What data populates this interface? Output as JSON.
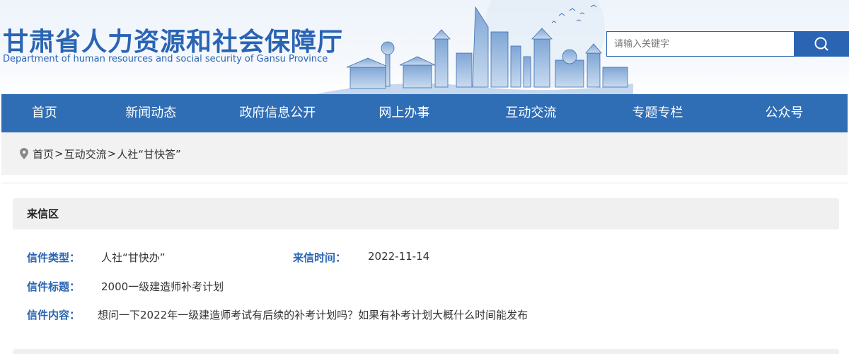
{
  "header": {
    "title": "甘肃省人力资源和社会保障厅",
    "subtitle": "Department of human resources and social security of Gansu Province",
    "search_placeholder": "请输入关键字",
    "search_icon": "search-icon"
  },
  "nav": {
    "items": [
      {
        "label": "首页"
      },
      {
        "label": "新闻动态"
      },
      {
        "label": "政府信息公开"
      },
      {
        "label": "网上办事"
      },
      {
        "label": "互动交流"
      },
      {
        "label": "专题专栏"
      },
      {
        "label": "公众号"
      }
    ]
  },
  "breadcrumb": {
    "icon": "location-pin-icon",
    "items": [
      "首页",
      "互动交流",
      "人社“甘快答”"
    ],
    "separator": ">"
  },
  "letter": {
    "section_title": "来信区",
    "type_label": "信件类型：",
    "type_value": "人社“甘快办”",
    "time_label": "来信时间：",
    "time_value": "2022-11-14",
    "subject_label": "信件标题：",
    "subject_value": "2000一级建造师补考计划",
    "content_label": "信件内容：",
    "content_value": "想问一下2022年一级建造师考试有后续的补考计划吗？如果有补考计划大概什么时间能发布"
  },
  "colors": {
    "brand_blue": "#2a64b3",
    "nav_blue": "#2f6db5"
  }
}
